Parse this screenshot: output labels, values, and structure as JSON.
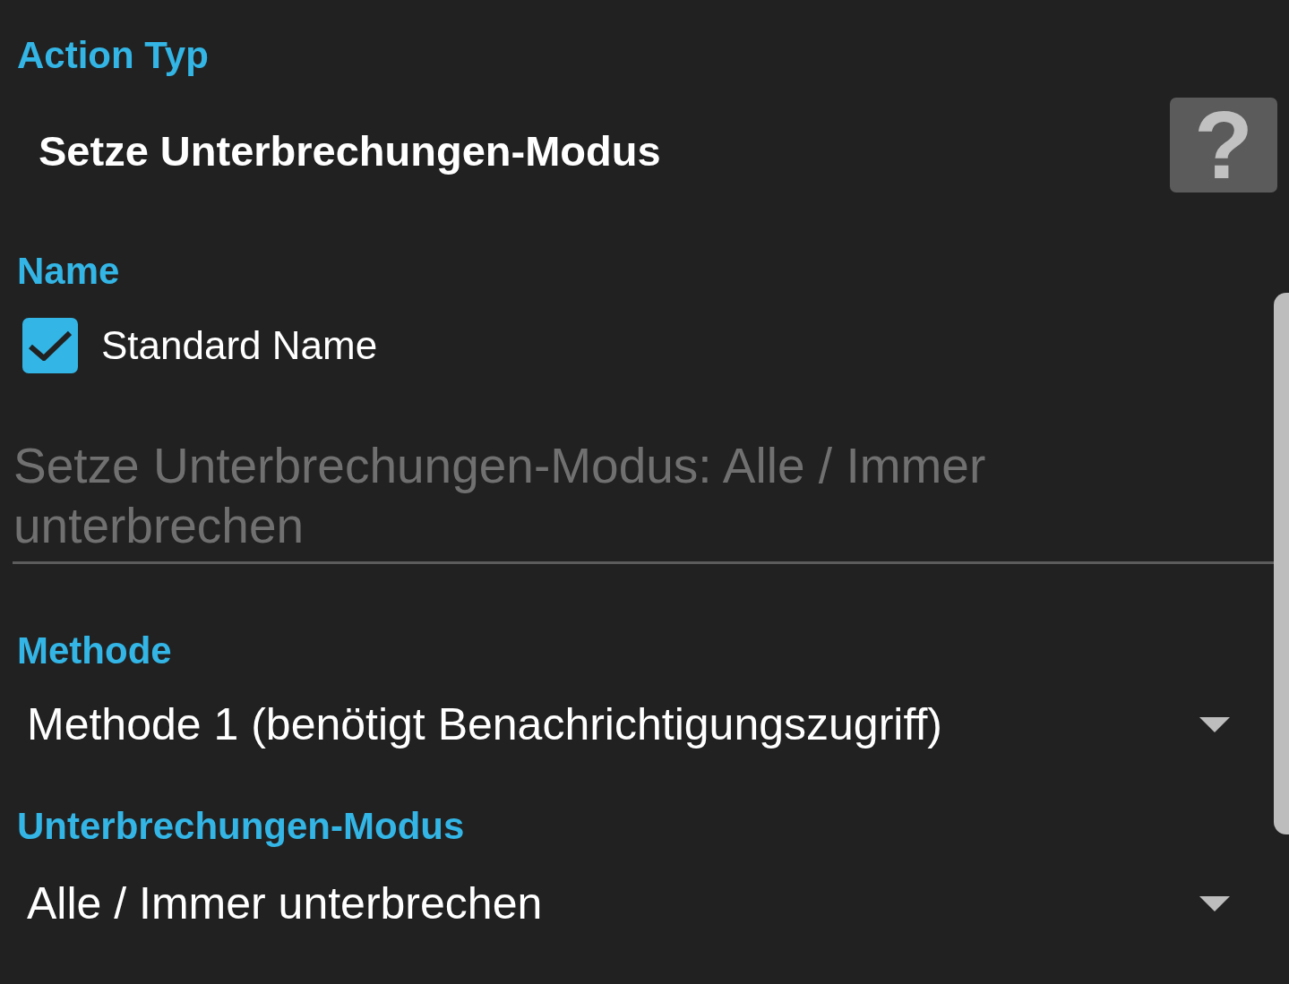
{
  "action_type": {
    "label": "Action Typ",
    "value": "Setze Unterbrechungen-Modus",
    "help_button": "?"
  },
  "name": {
    "label": "Name",
    "standard_name": {
      "label": "Standard Name",
      "checked": true
    },
    "field": {
      "value": "Setze Unterbrechungen-Modus: Alle / Immer unterbrechen",
      "disabled": true
    }
  },
  "method": {
    "label": "Methode",
    "value": "Methode 1 (benötigt Benachrichtigungszugriff)"
  },
  "interruption_mode": {
    "label": "Unterbrechungen-Modus",
    "value": "Alle / Immer unterbrechen"
  }
}
